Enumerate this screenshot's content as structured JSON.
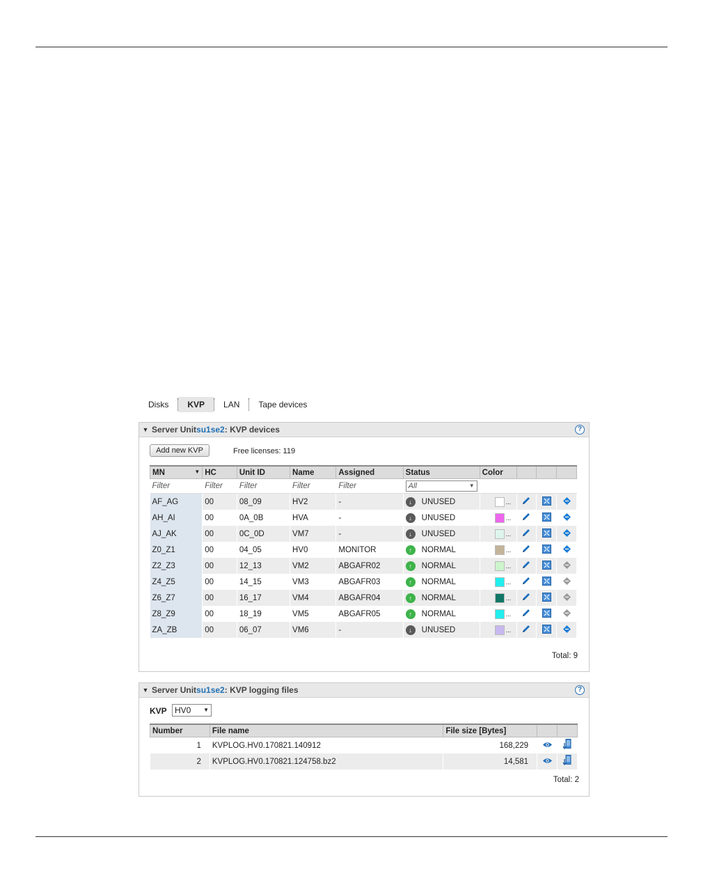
{
  "tabs": [
    {
      "label": "Disks",
      "active": false
    },
    {
      "label": "KVP",
      "active": true
    },
    {
      "label": "LAN",
      "active": false
    },
    {
      "label": "Tape devices",
      "active": false
    }
  ],
  "devices_panel": {
    "title_prefix": "Server Unit ",
    "unit": "su1se2",
    "title_suffix": ": KVP devices",
    "add_button": "Add new KVP",
    "free_licenses": "Free licenses: 119",
    "columns": [
      "MN",
      "HC",
      "Unit ID",
      "Name",
      "Assigned",
      "Status",
      "Color",
      "",
      "",
      ""
    ],
    "filter_placeholder": "Filter",
    "status_filter": "All",
    "rows": [
      {
        "mn": "AF_AG",
        "hc": "00",
        "unit_id": "08_09",
        "name": "HV2",
        "assigned": "-",
        "status": "UNUSED",
        "color": "#ffffff",
        "action_enabled": true
      },
      {
        "mn": "AH_AI",
        "hc": "00",
        "unit_id": "0A_0B",
        "name": "HVA",
        "assigned": "-",
        "status": "UNUSED",
        "color": "#ee66ee",
        "action_enabled": true
      },
      {
        "mn": "AJ_AK",
        "hc": "00",
        "unit_id": "0C_0D",
        "name": "VM7",
        "assigned": "-",
        "status": "UNUSED",
        "color": "#ddf5ec",
        "action_enabled": true
      },
      {
        "mn": "Z0_Z1",
        "hc": "00",
        "unit_id": "04_05",
        "name": "HV0",
        "assigned": "MONITOR",
        "status": "NORMAL",
        "color": "#c4b49a",
        "action_enabled": true
      },
      {
        "mn": "Z2_Z3",
        "hc": "00",
        "unit_id": "12_13",
        "name": "VM2",
        "assigned": "ABGAFR02",
        "status": "NORMAL",
        "color": "#ccf5cc",
        "action_enabled": false
      },
      {
        "mn": "Z4_Z5",
        "hc": "00",
        "unit_id": "14_15",
        "name": "VM3",
        "assigned": "ABGAFR03",
        "status": "NORMAL",
        "color": "#22eeee",
        "action_enabled": false
      },
      {
        "mn": "Z6_Z7",
        "hc": "00",
        "unit_id": "16_17",
        "name": "VM4",
        "assigned": "ABGAFR04",
        "status": "NORMAL",
        "color": "#117766",
        "action_enabled": false
      },
      {
        "mn": "Z8_Z9",
        "hc": "00",
        "unit_id": "18_19",
        "name": "VM5",
        "assigned": "ABGAFR05",
        "status": "NORMAL",
        "color": "#22eeee",
        "action_enabled": false
      },
      {
        "mn": "ZA_ZB",
        "hc": "00",
        "unit_id": "06_07",
        "name": "VM6",
        "assigned": "-",
        "status": "UNUSED",
        "color": "#c8b8f0",
        "action_enabled": true
      }
    ],
    "total": "Total: 9"
  },
  "logs_panel": {
    "title_prefix": "Server Unit ",
    "unit": "su1se2",
    "title_suffix": ": KVP logging files",
    "kvp_label": "KVP",
    "kvp_value": "HV0",
    "columns": [
      "Number",
      "File name",
      "File size [Bytes]",
      "",
      ""
    ],
    "rows": [
      {
        "number": "1",
        "file": "KVPLOG.HV0.170821.140912",
        "size": "168,229"
      },
      {
        "number": "2",
        "file": "KVPLOG.HV0.170821.124758.bz2",
        "size": "14,581"
      }
    ],
    "total": "Total: 2"
  },
  "icons": {
    "collapse": "caret-down-icon",
    "help": "help-icon",
    "status_unused": "arrow-down-circle-icon",
    "status_normal": "arrow-up-circle-icon",
    "edit": "pencil-icon",
    "console": "console-icon",
    "action": "diamond-arrow-icon",
    "view": "eye-icon",
    "download": "download-icon"
  }
}
